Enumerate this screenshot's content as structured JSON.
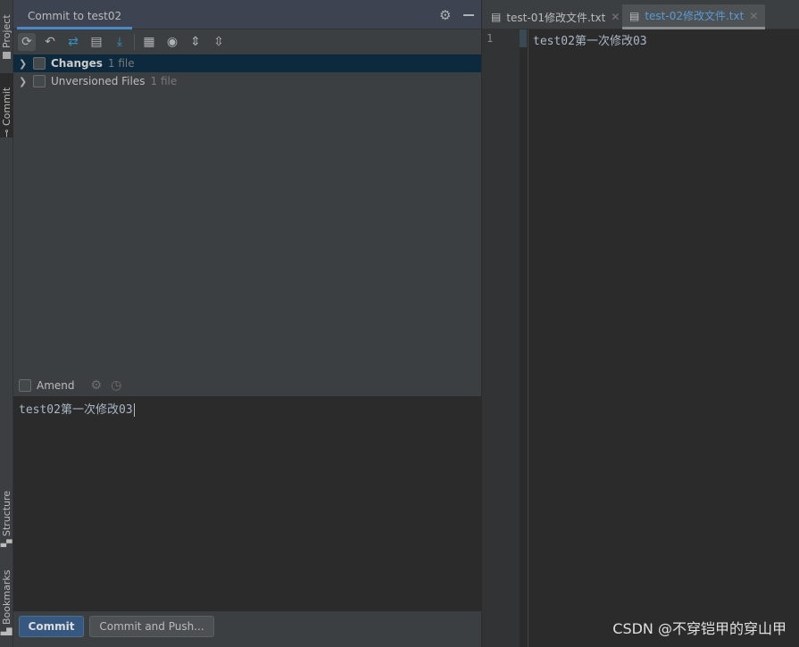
{
  "side_tabs": {
    "project": "Project",
    "commit": "Commit",
    "structure": "Structure",
    "bookmarks": "Bookmarks"
  },
  "panel": {
    "title": "Commit to test02"
  },
  "tree": [
    {
      "label": "Changes",
      "count": "1 file"
    },
    {
      "label": "Unversioned Files",
      "count": "1 file"
    }
  ],
  "amend": {
    "label": "Amend"
  },
  "message": "test02第一次修改03",
  "buttons": {
    "commit": "Commit",
    "commit_push": "Commit and Push..."
  },
  "editor": {
    "tabs": [
      {
        "label": "test-01修改文件.txt",
        "active": false
      },
      {
        "label": "test-02修改文件.txt",
        "active": true
      }
    ],
    "line_number": "1",
    "line": "test02第一次修改03"
  },
  "watermark": "CSDN @不穿铠甲的穿山甲",
  "colors": {
    "accent": "#4a88c7",
    "selected_row": "#0d293e",
    "commit_button": "#365880"
  }
}
